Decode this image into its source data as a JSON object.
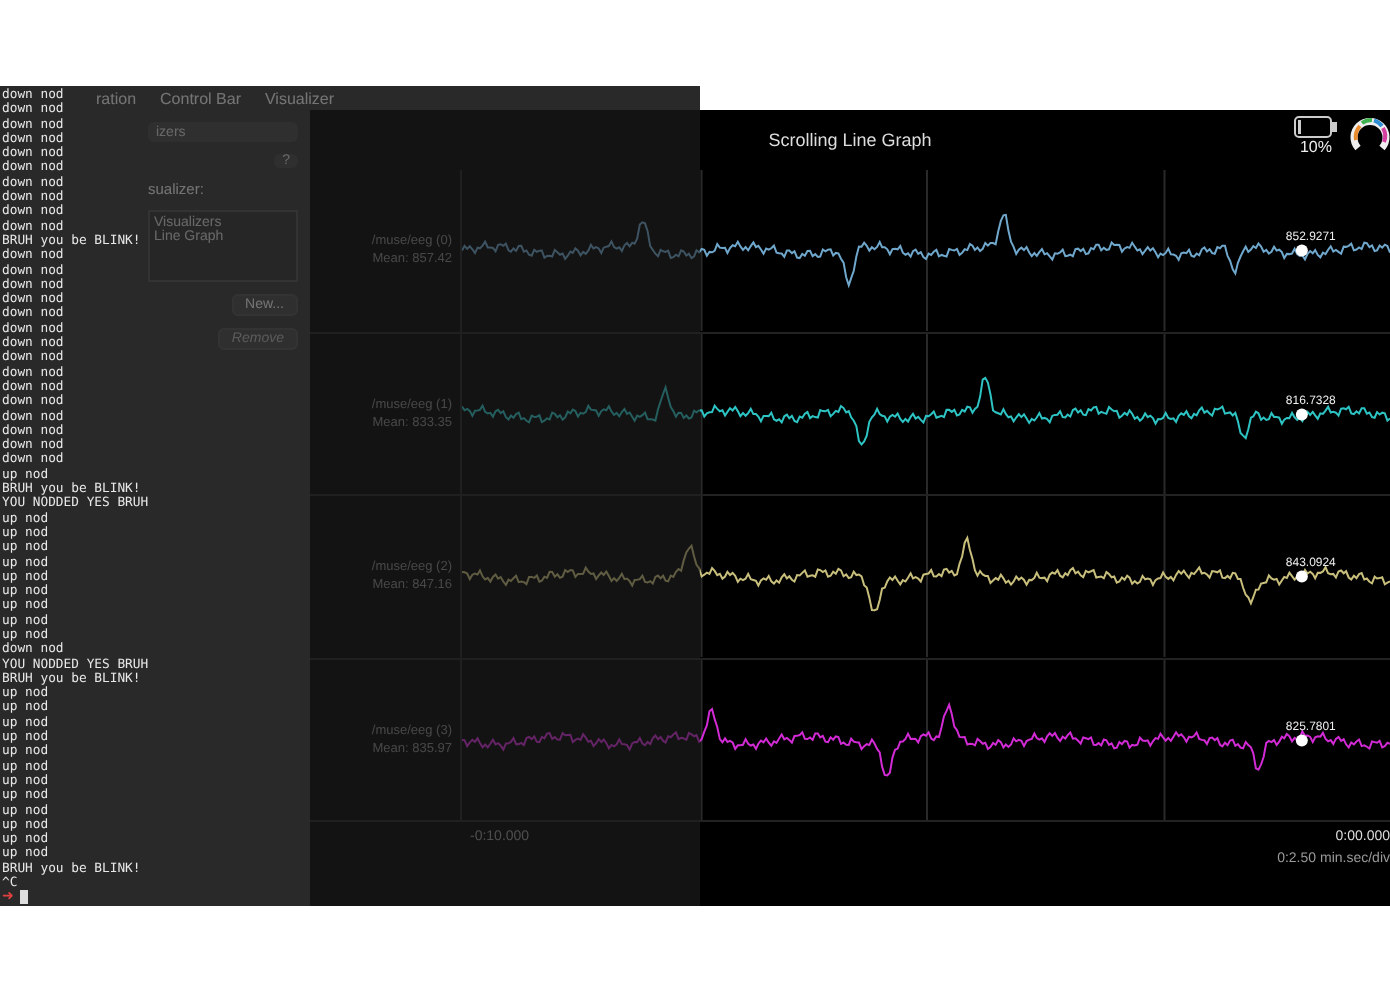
{
  "app": {
    "menu": [
      "ration",
      "Control Bar",
      "Visualizer"
    ],
    "sidebar": {
      "select": "izers",
      "help": "?",
      "label": "sualizer:",
      "list": [
        "Visualizers",
        "Line Graph"
      ],
      "buttons": [
        {
          "label": "New...",
          "disabled": false
        },
        {
          "label": "Remove",
          "disabled": true
        }
      ]
    }
  },
  "graph": {
    "title": "Scrolling Line Graph",
    "battery": {
      "level": 0.1,
      "reading": "10%"
    },
    "channels": [
      {
        "name": "/muse/eeg (0)",
        "mean": "Mean: 857.42",
        "value": "852.9271",
        "color": "#6fa8cc"
      },
      {
        "name": "/muse/eeg (1)",
        "mean": "Mean: 833.35",
        "value": "816.7328",
        "color": "#2ec4c4"
      },
      {
        "name": "/muse/eeg (2)",
        "mean": "Mean: 847.16",
        "value": "843.0924",
        "color": "#c9bf7c"
      },
      {
        "name": "/muse/eeg (3)",
        "mean": "Mean: 835.97",
        "value": "825.7801",
        "color": "#d22bd6"
      }
    ],
    "x_start": "-0:10.000",
    "x_end": "0:00.000",
    "scale": "0:2.50 min.sec/div"
  },
  "terminal": {
    "lines": [
      "down nod",
      "down nod",
      "down nod",
      "down nod",
      "down nod",
      "down nod",
      "down nod",
      "down nod",
      "down nod",
      "down nod",
      "BRUH you be BLINK!",
      "down nod",
      "down nod",
      "down nod",
      "down nod",
      "down nod",
      "down nod",
      "down nod",
      "down nod",
      "down nod",
      "down nod",
      "down nod",
      "down nod",
      "down nod",
      "down nod",
      "down nod",
      "up nod",
      "BRUH you be BLINK!",
      "YOU NODDED YES BRUH",
      "up nod",
      "up nod",
      "up nod",
      "up nod",
      "up nod",
      "up nod",
      "up nod",
      "up nod",
      "up nod",
      "down nod",
      "YOU NODDED YES BRUH",
      "BRUH you be BLINK!",
      "up nod",
      "up nod",
      "up nod",
      "up nod",
      "up nod",
      "up nod",
      "up nod",
      "up nod",
      "up nod",
      "up nod",
      "up nod",
      "up nod",
      "BRUH you be BLINK!",
      "^C"
    ],
    "prompt": "➜"
  }
}
